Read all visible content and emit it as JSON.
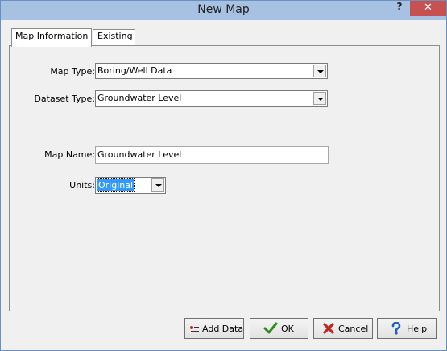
{
  "window": {
    "title": "New Map",
    "help_glyph": "?",
    "close_glyph": "✕"
  },
  "tabs": [
    {
      "label": "Map Information",
      "active": true
    },
    {
      "label": "Existing",
      "active": false
    }
  ],
  "form": {
    "map_type": {
      "label": "Map Type:",
      "value": "Boring/Well Data"
    },
    "dataset_type": {
      "label": "Dataset Type:",
      "value": "Groundwater Level"
    },
    "map_name": {
      "label": "Map Name:",
      "value": "Groundwater Level"
    },
    "units": {
      "label": "Units:",
      "value": "Original"
    }
  },
  "buttons": {
    "add_data": {
      "label": "Add Data",
      "icon": "add-data-icon"
    },
    "ok": {
      "label": "OK",
      "icon": "checkmark-icon",
      "icon_color": "#2e8b1e"
    },
    "cancel": {
      "label": "Cancel",
      "icon": "x-icon",
      "icon_color": "#c0261c"
    },
    "help": {
      "label": "Help",
      "icon": "question-icon",
      "icon_color": "#1f5fbf"
    }
  }
}
